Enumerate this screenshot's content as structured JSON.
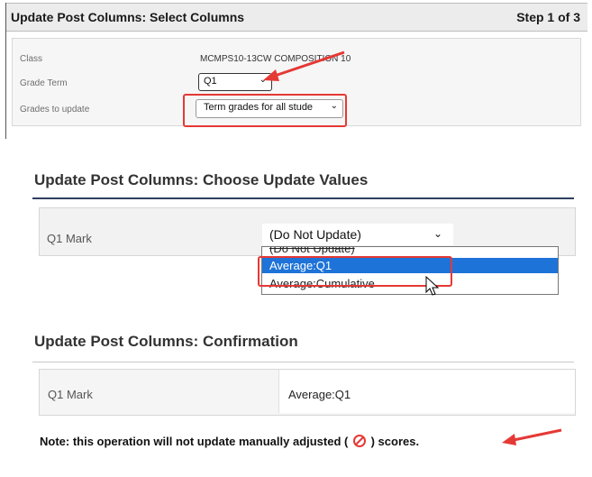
{
  "panel1": {
    "title": "Update Post Columns: Select Columns",
    "step": "Step 1 of 3",
    "rows": [
      {
        "label": "Class",
        "value": "MCMPS10-13CW  COMPOSITION 10"
      },
      {
        "label": "Grade Term",
        "value": "Q1"
      },
      {
        "label": "Grades to update",
        "value": "Term grades for all stude"
      }
    ]
  },
  "panel2": {
    "title": "Update Post Columns: Choose Update Values",
    "row_label": "Q1 Mark",
    "select_value": "(Do Not Update)",
    "options": [
      "(Do Not Update)",
      "Average:Q1",
      "Average:Cumulative"
    ],
    "highlighted_option": "Average:Q1"
  },
  "panel3": {
    "title": "Update Post Columns: Confirmation",
    "row_label": "Q1 Mark",
    "row_value": "Average:Q1",
    "note_before": "Note: this operation will not update manually adjusted (",
    "note_after": ") scores."
  },
  "colors": {
    "annotation_red": "#e53935",
    "highlight_blue": "#1e73d8",
    "header_rule": "#2f3f5f"
  }
}
